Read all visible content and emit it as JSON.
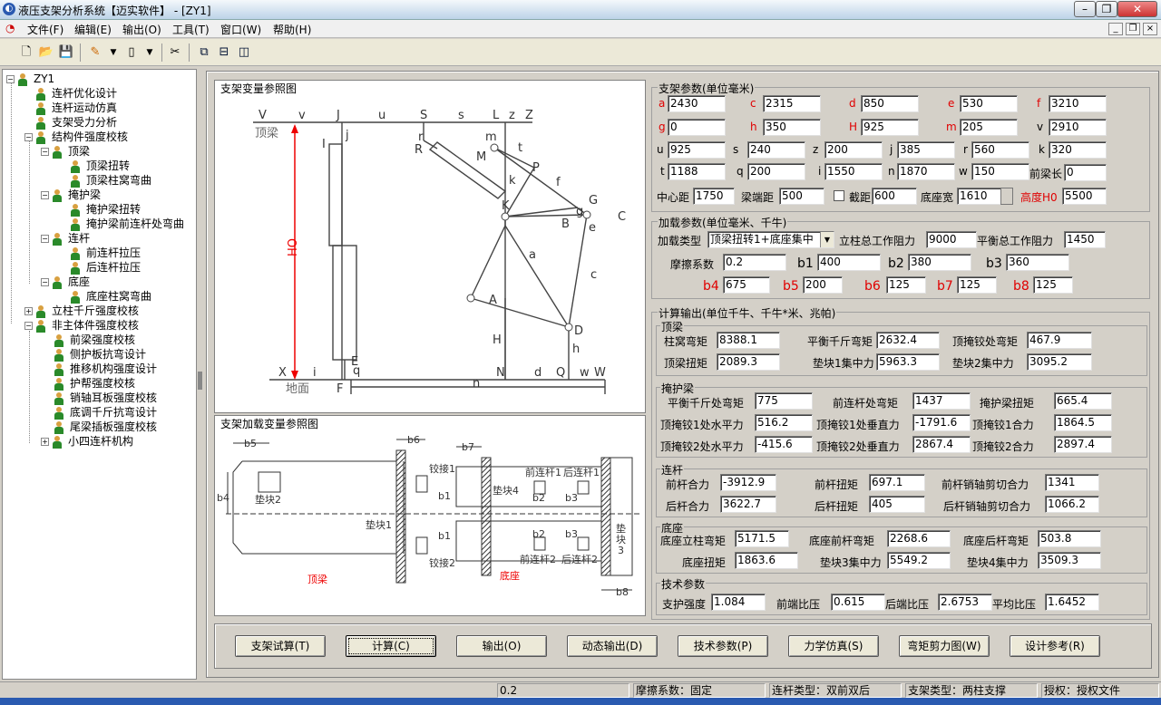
{
  "window": {
    "title": "液压支架分析系统【迈实软件】 - [ZY1]"
  },
  "menu": [
    "文件(F)",
    "编辑(E)",
    "输出(O)",
    "工具(T)",
    "窗口(W)",
    "帮助(H)"
  ],
  "tree": {
    "root": "ZY1",
    "items": [
      {
        "label": "连杆优化设计"
      },
      {
        "label": "连杆运动仿真"
      },
      {
        "label": "支架受力分析"
      },
      {
        "label": "结构件强度校核"
      },
      {
        "label": "顶梁"
      },
      {
        "label": "顶梁扭转"
      },
      {
        "label": "顶梁柱窝弯曲"
      },
      {
        "label": "掩护梁"
      },
      {
        "label": "掩护梁扭转"
      },
      {
        "label": "掩护梁前连杆处弯曲"
      },
      {
        "label": "连杆"
      },
      {
        "label": "前连杆拉压"
      },
      {
        "label": "后连杆拉压"
      },
      {
        "label": "底座"
      },
      {
        "label": "底座柱窝弯曲"
      },
      {
        "label": "立柱千斤强度校核"
      },
      {
        "label": "非主体件强度校核"
      },
      {
        "label": "前梁强度校核"
      },
      {
        "label": "侧护板抗弯设计"
      },
      {
        "label": "推移机构强度设计"
      },
      {
        "label": "护帮强度校核"
      },
      {
        "label": "销轴耳板强度校核"
      },
      {
        "label": "底调千斤抗弯设计"
      },
      {
        "label": "尾梁插板强度校核"
      },
      {
        "label": "小四连杆机构"
      }
    ]
  },
  "diagram1": {
    "title": "支架变量参照图",
    "labels": {
      "V": "V",
      "v": "v",
      "J": "J",
      "u": "u",
      "S": "S",
      "s": "s",
      "L": "L",
      "z": "z",
      "Z": "Z",
      "dingliang": "顶梁",
      "j": "j",
      "I": "I",
      "r": "r",
      "R": "R",
      "m": "m",
      "t": "t",
      "M": "M",
      "P": "P",
      "k": "k",
      "f": "f",
      "K": "K",
      "G": "G",
      "g": "g",
      "C": "C",
      "B": "B",
      "e": "e",
      "H0": "HO",
      "a": "a",
      "c": "c",
      "A": "A",
      "D": "D",
      "H": "H",
      "h": "h",
      "E": "E",
      "X": "X",
      "i": "i",
      "q": "q",
      "N": "N",
      "d": "d",
      "Q": "Q",
      "w": "w",
      "W": "W",
      "dimian": "地面",
      "F": "F",
      "n": "n"
    }
  },
  "diagram2": {
    "title": "支架加载变量参照图",
    "labels": {
      "b5": "b5",
      "b6": "b6",
      "b7": "b7",
      "b4": "b4",
      "dk2": "垫块2",
      "dk1": "垫块1",
      "dk4": "垫块4",
      "jj1": "铰接1",
      "jj2": "铰接2",
      "b1a": "b1",
      "b1b": "b1",
      "b2a": "b2",
      "b2b": "b2",
      "b3a": "b3",
      "b3b": "b3",
      "qlg1": "前连杆1",
      "hlg1": "后连杆1",
      "qlg2": "前连杆2",
      "hlg2": "后连杆2",
      "dk3a": "垫",
      "dk3b": "块",
      "dk3c": "3",
      "dl": "顶梁",
      "dz": "底座",
      "b8": "b8"
    }
  },
  "support": {
    "title": "支架参数(单位毫米)",
    "a": {
      "label": "a",
      "value": "2430"
    },
    "c": {
      "label": "c",
      "value": "2315"
    },
    "d": {
      "label": "d",
      "value": "850"
    },
    "e": {
      "label": "e",
      "value": "530"
    },
    "f": {
      "label": "f",
      "value": "3210"
    },
    "g": {
      "label": "g",
      "value": "0"
    },
    "h": {
      "label": "h",
      "value": "350"
    },
    "H": {
      "label": "H",
      "value": "925"
    },
    "m": {
      "label": "m",
      "value": "205"
    },
    "v": {
      "label": "v",
      "value": "2910"
    },
    "u": {
      "label": "u",
      "value": "925"
    },
    "s": {
      "label": "s",
      "value": "240"
    },
    "z": {
      "label": "z",
      "value": "200"
    },
    "j": {
      "label": "j",
      "value": "385"
    },
    "r": {
      "label": "r",
      "value": "560"
    },
    "k": {
      "label": "k",
      "value": "320"
    },
    "t": {
      "label": "t",
      "value": "1188"
    },
    "q": {
      "label": "q",
      "value": "200"
    },
    "i": {
      "label": "i",
      "value": "1550"
    },
    "n": {
      "label": "n",
      "value": "1870"
    },
    "w": {
      "label": "w",
      "value": "150"
    },
    "ql": {
      "label": "前梁长",
      "value": "0"
    },
    "zxj": {
      "label": "中心距",
      "value": "1750"
    },
    "ldj": {
      "label": "梁端距",
      "value": "500"
    },
    "jj": {
      "label": "截距",
      "value": "600"
    },
    "dzk": {
      "label": "底座宽",
      "value": "1610"
    },
    "gd": {
      "label": "高度H0",
      "value": "5500"
    }
  },
  "load": {
    "title": "加载参数(单位毫米、千牛)",
    "type_label": "加载类型",
    "type_value": "顶梁扭转1+底座集中",
    "lz_label": "立柱总工作阻力",
    "lz_value": "9000",
    "ph_label": "平衡总工作阻力",
    "ph_value": "1450",
    "mc_label": "摩擦系数",
    "mc_value": "0.2",
    "b1": {
      "label": "b1",
      "value": "400"
    },
    "b2": {
      "label": "b2",
      "value": "380"
    },
    "b3": {
      "label": "b3",
      "value": "360"
    },
    "b4": {
      "label": "b4",
      "value": "675"
    },
    "b5": {
      "label": "b5",
      "value": "200"
    },
    "b6": {
      "label": "b6",
      "value": "125"
    },
    "b7": {
      "label": "b7",
      "value": "125"
    },
    "b8": {
      "label": "b8",
      "value": "125"
    }
  },
  "output": {
    "title": "计算输出(单位千牛、千牛*米、兆帕)",
    "dingliang": {
      "title": "顶梁",
      "zwwj": {
        "label": "柱窝弯矩",
        "value": "8388.1"
      },
      "phqjwj": {
        "label": "平衡千斤弯矩",
        "value": "2632.4"
      },
      "dyjwj": {
        "label": "顶掩铰处弯矩",
        "value": "467.9"
      },
      "dlnj": {
        "label": "顶梁扭矩",
        "value": "2089.3"
      },
      "dk1": {
        "label": "垫块1集中力",
        "value": "5963.3"
      },
      "dk2": {
        "label": "垫块2集中力",
        "value": "3095.2"
      }
    },
    "yanhu": {
      "title": "掩护梁",
      "phqj": {
        "label": "平衡千斤处弯矩",
        "value": "775"
      },
      "qlg": {
        "label": "前连杆处弯矩",
        "value": "1437"
      },
      "yhlnj": {
        "label": "掩护梁扭矩",
        "value": "665.4"
      },
      "d1sp": {
        "label": "顶掩铰1处水平力",
        "value": "516.2"
      },
      "d1cz": {
        "label": "顶掩铰1处垂直力",
        "value": "-1791.6"
      },
      "d1hl": {
        "label": "顶掩铰1合力",
        "value": "1864.5"
      },
      "d2sp": {
        "label": "顶掩铰2处水平力",
        "value": "-415.6"
      },
      "d2cz": {
        "label": "顶掩铰2处垂直力",
        "value": "2867.4"
      },
      "d2hl": {
        "label": "顶掩铰2合力",
        "value": "2897.4"
      }
    },
    "liangan": {
      "title": "连杆",
      "qghl": {
        "label": "前杆合力",
        "value": "-3912.9"
      },
      "qgnj": {
        "label": "前杆扭矩",
        "value": "697.1"
      },
      "qgxz": {
        "label": "前杆销轴剪切合力",
        "value": "1341"
      },
      "hghl": {
        "label": "后杆合力",
        "value": "3622.7"
      },
      "hgnj": {
        "label": "后杆扭矩",
        "value": "405"
      },
      "hgxz": {
        "label": "后杆销轴剪切合力",
        "value": "1066.2"
      }
    },
    "dizuo": {
      "title": "底座",
      "lzwj": {
        "label": "底座立柱弯矩",
        "value": "5171.5"
      },
      "qgwj": {
        "label": "底座前杆弯矩",
        "value": "2268.6"
      },
      "hgwj": {
        "label": "底座后杆弯矩",
        "value": "503.8"
      },
      "dznj": {
        "label": "底座扭矩",
        "value": "1863.6"
      },
      "dk3": {
        "label": "垫块3集中力",
        "value": "5549.2"
      },
      "dk4": {
        "label": "垫块4集中力",
        "value": "3509.3"
      }
    },
    "tech": {
      "title": "技术参数",
      "zhqd": {
        "label": "支护强度",
        "value": "1.084"
      },
      "qdby": {
        "label": "前端比压",
        "value": "0.615"
      },
      "hdby": {
        "label": "后端比压",
        "value": "2.6753"
      },
      "pjby": {
        "label": "平均比压",
        "value": "1.6452"
      }
    }
  },
  "buttons": {
    "trial": "支架试算(T)",
    "calc": "计算(C)",
    "output": "输出(O)",
    "dyn": "动态输出(D)",
    "tech": "技术参数(P)",
    "sim": "力学仿真(S)",
    "bend": "弯矩剪力图(W)",
    "ref": "设计参考(R)"
  },
  "status": {
    "val": "0.2",
    "friction": "摩擦系数：固定",
    "link": "连杆类型：双前双后",
    "support": "支架类型：两柱支撑",
    "auth": "授权：授权文件"
  }
}
